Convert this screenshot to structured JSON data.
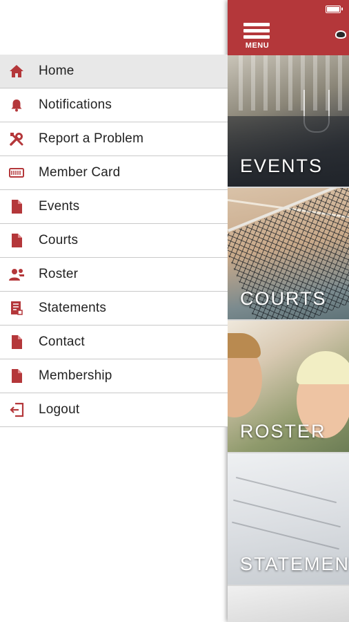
{
  "colors": {
    "accent": "#b4373a",
    "drawer_bg": "#ffffff",
    "active_bg": "#e8e8e8"
  },
  "header": {
    "menu_label": "MENU"
  },
  "drawer": {
    "items": [
      {
        "label": "Home",
        "icon": "home-icon",
        "active": true
      },
      {
        "label": "Notifications",
        "icon": "bell-icon"
      },
      {
        "label": "Report a Problem",
        "icon": "tools-icon"
      },
      {
        "label": "Member Card",
        "icon": "card-icon"
      },
      {
        "label": "Events",
        "icon": "document-icon"
      },
      {
        "label": "Courts",
        "icon": "document-icon"
      },
      {
        "label": "Roster",
        "icon": "people-icon"
      },
      {
        "label": "Statements",
        "icon": "statement-icon"
      },
      {
        "label": "Contact",
        "icon": "document-icon"
      },
      {
        "label": "Membership",
        "icon": "document-icon"
      },
      {
        "label": "Logout",
        "icon": "logout-icon"
      }
    ]
  },
  "tiles": [
    {
      "caption": "EVENTS"
    },
    {
      "caption": "COURTS"
    },
    {
      "caption": "ROSTER"
    },
    {
      "caption": "STATEMENTS"
    }
  ]
}
